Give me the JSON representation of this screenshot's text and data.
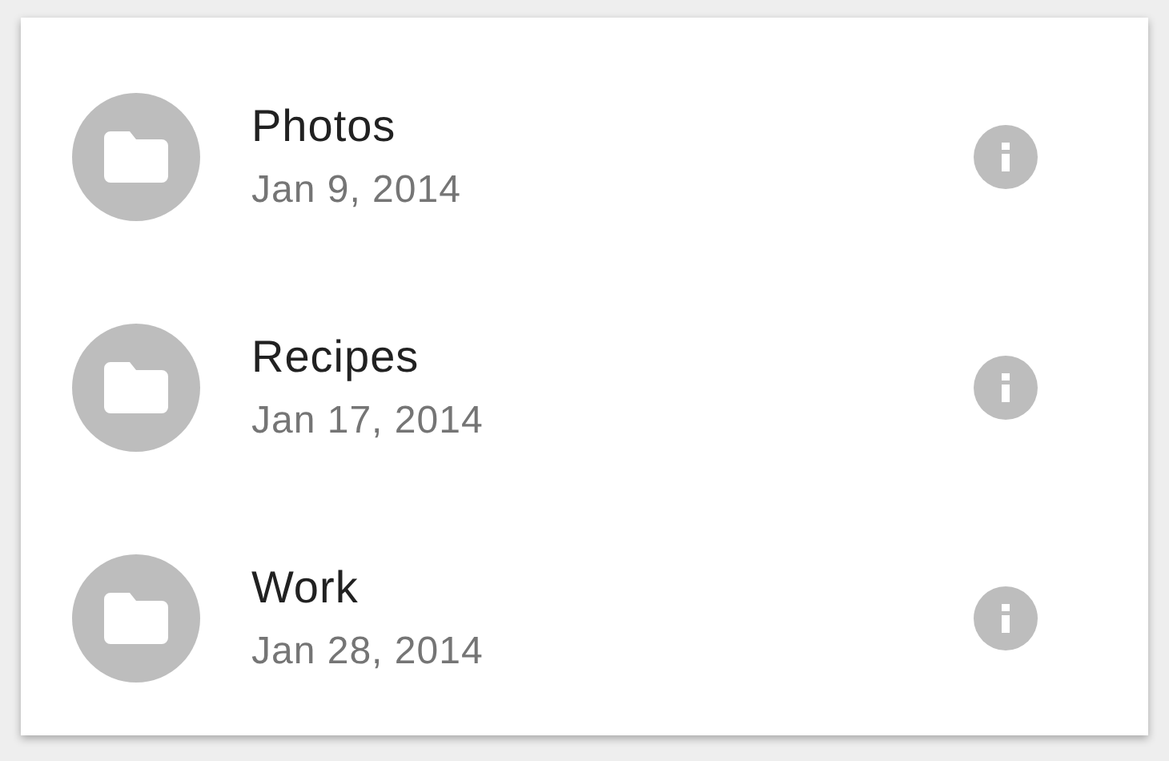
{
  "items": [
    {
      "title": "Photos",
      "date": "Jan 9, 2014"
    },
    {
      "title": "Recipes",
      "date": "Jan 17, 2014"
    },
    {
      "title": "Work",
      "date": "Jan 28, 2014"
    }
  ]
}
